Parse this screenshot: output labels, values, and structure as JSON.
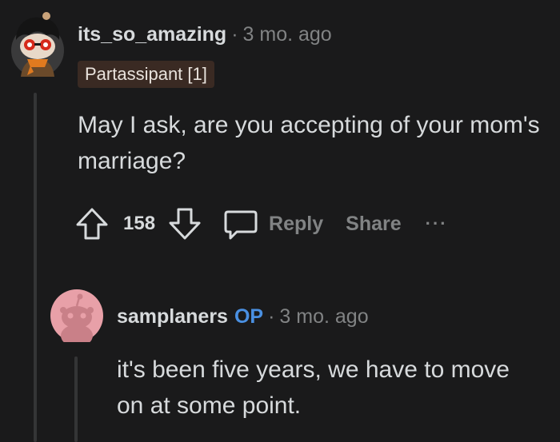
{
  "comment1": {
    "username": "its_so_amazing",
    "separator": "·",
    "time": "3 mo. ago",
    "flair": "Partassipant [1]",
    "body": "May I ask, are you accepting of your mom's marriage?",
    "actions": {
      "upvote_icon": "upvote-arrow-icon",
      "vote_count": "158",
      "downvote_icon": "downvote-arrow-icon",
      "comment_icon": "speech-bubble-icon",
      "reply_label": "Reply",
      "share_label": "Share",
      "more_label": "···"
    }
  },
  "comment2": {
    "username": "samplaners",
    "op_badge": "OP",
    "separator": "·",
    "time": "3 mo. ago",
    "body": "it's been five years, we have to move on at some point."
  },
  "colors": {
    "background": "#1a1a1b",
    "text": "#d7dadc",
    "muted": "#818384",
    "op_blue": "#4a90e2",
    "flair_bg": "#3a2a23",
    "avatar2_bg": "#e8a0a8"
  }
}
